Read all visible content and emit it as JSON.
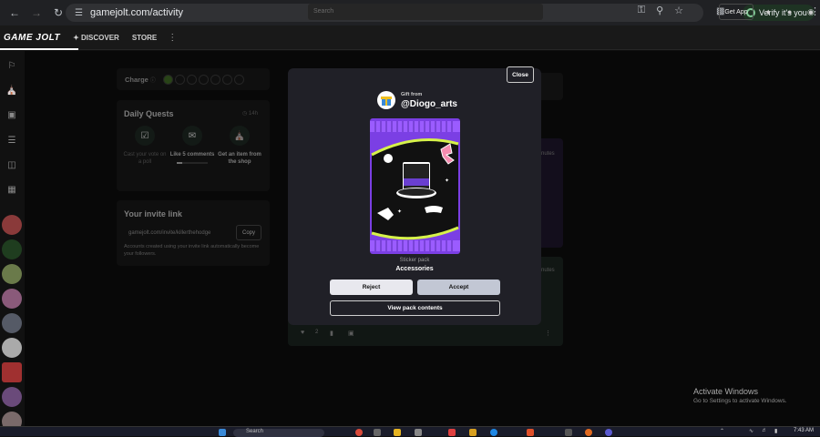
{
  "browser": {
    "url": "gamejolt.com/activity",
    "verify_label": "Verify it's you"
  },
  "gamejolt": {
    "logo": "GAME JOLT",
    "nav": [
      "DISCOVER",
      "STORE"
    ],
    "search_placeholder": "Search",
    "get_app_label": "Get App"
  },
  "sidebar": {
    "charge_label": "Charge",
    "daily_quests": {
      "title": "Daily Quests",
      "timer": "14h",
      "items": [
        {
          "text": "Cast your vote on a poll",
          "done": false
        },
        {
          "text": "Like 5 comments",
          "done": true
        },
        {
          "text": "Get an item from the shop",
          "done": true
        }
      ]
    },
    "invite": {
      "title": "Your invite link",
      "url": "gamejolt.com/invite/killerthehodge",
      "copy_label": "Copy",
      "note": "Accounts created using your invite link automatically become your followers."
    }
  },
  "feed": {
    "like_count": "2",
    "time_fragment": "nutes"
  },
  "modal": {
    "close_label": "Close",
    "gift_from_label": "Gift from",
    "gift_user": "@Diogo_arts",
    "pack_type": "Sticker pack",
    "pack_name": "Accessories",
    "reject_label": "Reject",
    "accept_label": "Accept",
    "view_label": "View pack contents"
  },
  "windows_notice": {
    "title": "Activate Windows",
    "subtitle": "Go to Settings to activate Windows."
  },
  "taskbar": {
    "search_placeholder": "Search",
    "time": "7:43 AM"
  },
  "colors": {
    "pack_purple": "#7b3fe4",
    "pack_band": "#9b5cff",
    "pack_lime": "#d6f24a"
  }
}
